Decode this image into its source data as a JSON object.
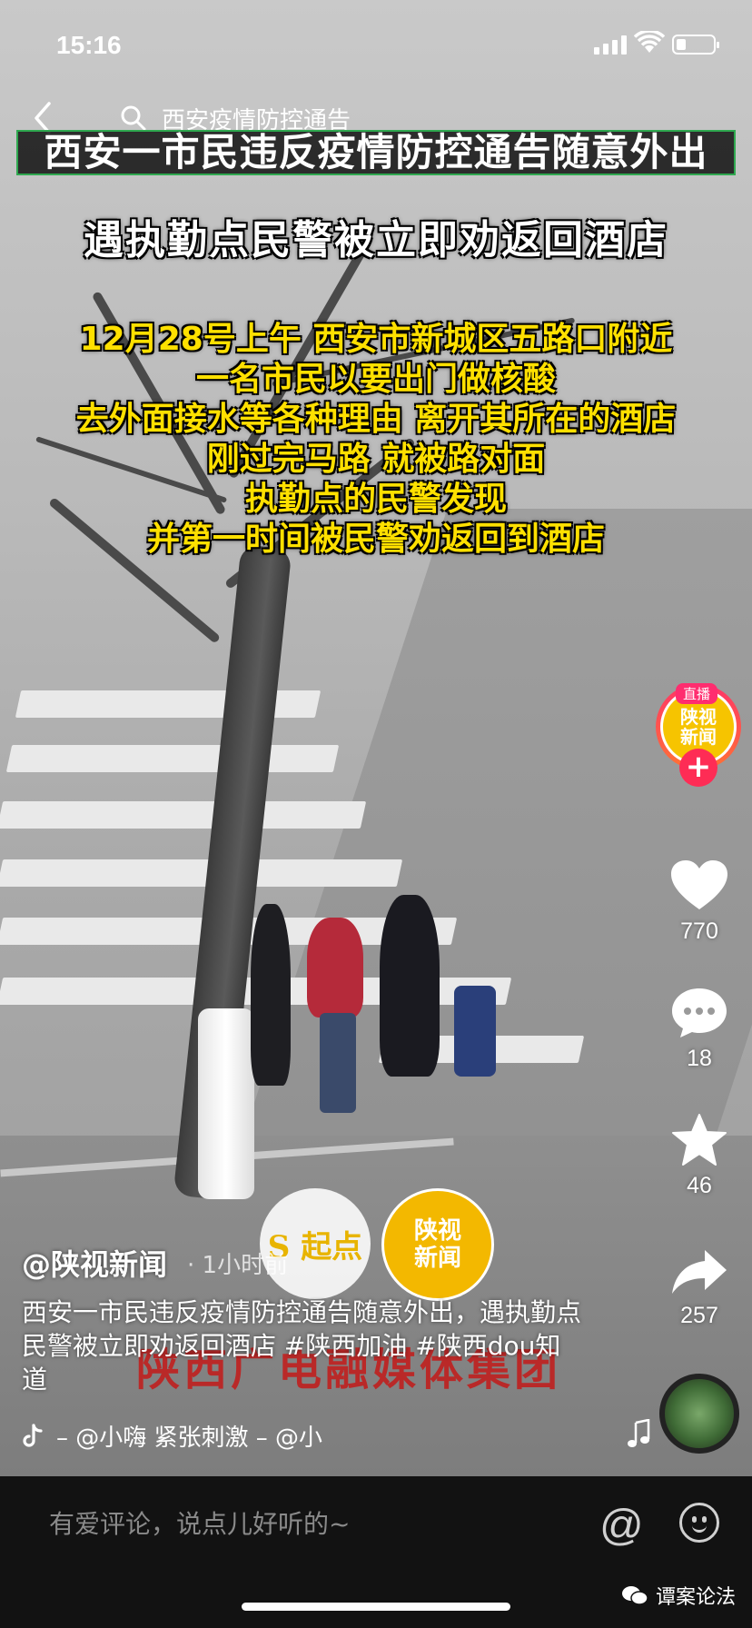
{
  "status_bar": {
    "time": "15:16",
    "battery_level": 0.25
  },
  "header": {
    "search_text": "西安疫情防控通告"
  },
  "video": {
    "headline": "西安一市民违反疫情防控通告随意外出",
    "subheadline": "遇执勤点民警被立即劝返回酒店",
    "story_lines": [
      "12月28号上午  西安市新城区五路口附近",
      "一名市民以要出门做核酸",
      "去外面接水等各种理由  离开其所在的酒店",
      "刚过完马路  就被路对面",
      "执勤点的民警发现",
      "并第一时间被民警劝返回到酒店"
    ],
    "watermark_logo_1": "S 起点",
    "watermark_logo_2_line1": "陕视",
    "watermark_logo_2_line2": "新闻",
    "group_watermark": "陕西广电融媒体集团"
  },
  "rail": {
    "live_label": "直播",
    "avatar_line1": "陕视",
    "avatar_line2": "新闻",
    "follow_symbol": "+",
    "likes": "770",
    "comments": "18",
    "favorites": "46",
    "shares": "257"
  },
  "post": {
    "author": "@陕视新闻",
    "time_ago": "· 1小时前",
    "description": "西安一市民违反疫情防控通告随意外出，遇执勤点民警被立即劝返回酒店 #陕西加油 #陕西dou知道",
    "music_text": "– @小嗨    紧张刺激 – @小"
  },
  "comment_bar": {
    "placeholder": "有爱评论，说点儿好听的~",
    "at_symbol": "@"
  },
  "wechat_watermark": "谭案论法",
  "colors": {
    "accent_pink": "#fe2c55",
    "caption_yellow": "#ffe000",
    "headline_border": "#2fa84f"
  },
  "icons": [
    "back-icon",
    "search-icon",
    "heart-icon",
    "comment-icon",
    "star-icon",
    "share-icon",
    "tiktok-icon",
    "music-note-icon",
    "at-icon",
    "emoji-icon",
    "wechat-icon"
  ]
}
